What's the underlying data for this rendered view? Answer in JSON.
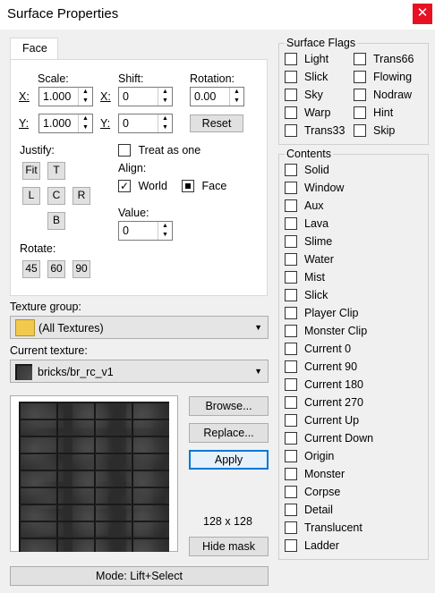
{
  "window": {
    "title": "Surface Properties",
    "close_glyph": "✕"
  },
  "tab": {
    "label": "Face"
  },
  "scale": {
    "label": "Scale:",
    "x_label": "X:",
    "y_label": "Y:",
    "x_value": "1.000",
    "y_value": "1.000"
  },
  "shift": {
    "label": "Shift:",
    "x_label": "X:",
    "y_label": "Y:",
    "x_value": "0",
    "y_value": "0"
  },
  "rotation": {
    "label": "Rotation:",
    "value": "0.00",
    "reset": "Reset"
  },
  "justify": {
    "label": "Justify:",
    "fit": "Fit",
    "t": "T",
    "l": "L",
    "c": "C",
    "r": "R",
    "b": "B"
  },
  "treat_as_one": "Treat as one",
  "align": {
    "label": "Align:",
    "world": "World",
    "face": "Face",
    "world_checked": true,
    "face_checked": true
  },
  "value": {
    "label": "Value:",
    "value": "0"
  },
  "rotate": {
    "label": "Rotate:",
    "b45": "45",
    "b60": "60",
    "b90": "90"
  },
  "texture_group": {
    "label": "Texture group:",
    "value": "(All Textures)",
    "icon": "folder-icon"
  },
  "current_texture": {
    "label": "Current texture:",
    "value": "bricks/br_rc_v1"
  },
  "buttons": {
    "browse": "Browse...",
    "replace": "Replace...",
    "apply": "Apply",
    "hide_mask": "Hide mask"
  },
  "texture_size": "128 x 128",
  "mode": "Mode: Lift+Select",
  "surface_flags": {
    "label": "Surface Flags",
    "left": [
      "Light",
      "Slick",
      "Sky",
      "Warp",
      "Trans33"
    ],
    "right": [
      "Trans66",
      "Flowing",
      "Nodraw",
      "Hint",
      "Skip"
    ]
  },
  "contents": {
    "label": "Contents",
    "items": [
      "Solid",
      "Window",
      "Aux",
      "Lava",
      "Slime",
      "Water",
      "Mist",
      "Slick",
      "Player Clip",
      "Monster Clip",
      "Current 0",
      "Current 90",
      "Current 180",
      "Current 270",
      "Current Up",
      "Current Down",
      "Origin",
      "Monster",
      "Corpse",
      "Detail",
      "Translucent",
      "Ladder"
    ]
  },
  "colors": {
    "accent": "#0078d7",
    "close": "#e81123"
  }
}
